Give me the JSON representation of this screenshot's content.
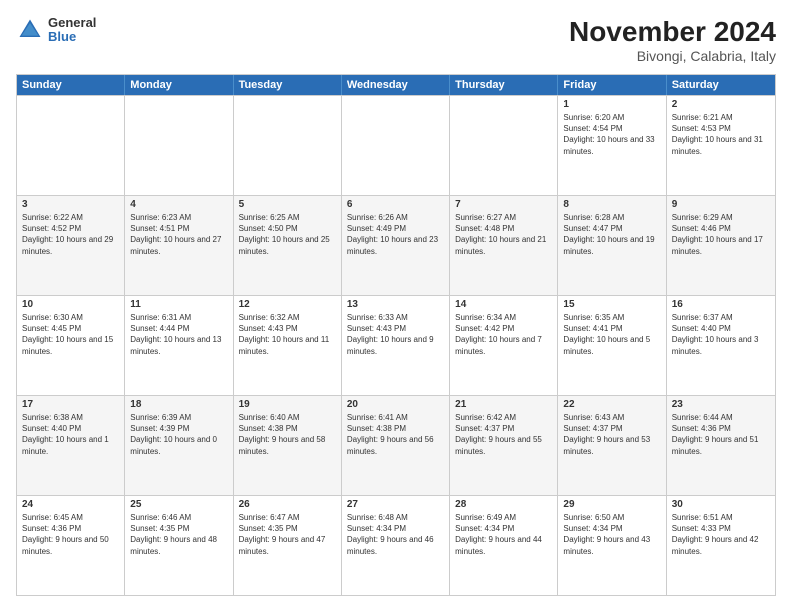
{
  "logo": {
    "general": "General",
    "blue": "Blue"
  },
  "title": "November 2024",
  "subtitle": "Bivongi, Calabria, Italy",
  "days": [
    "Sunday",
    "Monday",
    "Tuesday",
    "Wednesday",
    "Thursday",
    "Friday",
    "Saturday"
  ],
  "rows": [
    [
      {
        "num": "",
        "info": ""
      },
      {
        "num": "",
        "info": ""
      },
      {
        "num": "",
        "info": ""
      },
      {
        "num": "",
        "info": ""
      },
      {
        "num": "",
        "info": ""
      },
      {
        "num": "1",
        "info": "Sunrise: 6:20 AM\nSunset: 4:54 PM\nDaylight: 10 hours and 33 minutes."
      },
      {
        "num": "2",
        "info": "Sunrise: 6:21 AM\nSunset: 4:53 PM\nDaylight: 10 hours and 31 minutes."
      }
    ],
    [
      {
        "num": "3",
        "info": "Sunrise: 6:22 AM\nSunset: 4:52 PM\nDaylight: 10 hours and 29 minutes."
      },
      {
        "num": "4",
        "info": "Sunrise: 6:23 AM\nSunset: 4:51 PM\nDaylight: 10 hours and 27 minutes."
      },
      {
        "num": "5",
        "info": "Sunrise: 6:25 AM\nSunset: 4:50 PM\nDaylight: 10 hours and 25 minutes."
      },
      {
        "num": "6",
        "info": "Sunrise: 6:26 AM\nSunset: 4:49 PM\nDaylight: 10 hours and 23 minutes."
      },
      {
        "num": "7",
        "info": "Sunrise: 6:27 AM\nSunset: 4:48 PM\nDaylight: 10 hours and 21 minutes."
      },
      {
        "num": "8",
        "info": "Sunrise: 6:28 AM\nSunset: 4:47 PM\nDaylight: 10 hours and 19 minutes."
      },
      {
        "num": "9",
        "info": "Sunrise: 6:29 AM\nSunset: 4:46 PM\nDaylight: 10 hours and 17 minutes."
      }
    ],
    [
      {
        "num": "10",
        "info": "Sunrise: 6:30 AM\nSunset: 4:45 PM\nDaylight: 10 hours and 15 minutes."
      },
      {
        "num": "11",
        "info": "Sunrise: 6:31 AM\nSunset: 4:44 PM\nDaylight: 10 hours and 13 minutes."
      },
      {
        "num": "12",
        "info": "Sunrise: 6:32 AM\nSunset: 4:43 PM\nDaylight: 10 hours and 11 minutes."
      },
      {
        "num": "13",
        "info": "Sunrise: 6:33 AM\nSunset: 4:43 PM\nDaylight: 10 hours and 9 minutes."
      },
      {
        "num": "14",
        "info": "Sunrise: 6:34 AM\nSunset: 4:42 PM\nDaylight: 10 hours and 7 minutes."
      },
      {
        "num": "15",
        "info": "Sunrise: 6:35 AM\nSunset: 4:41 PM\nDaylight: 10 hours and 5 minutes."
      },
      {
        "num": "16",
        "info": "Sunrise: 6:37 AM\nSunset: 4:40 PM\nDaylight: 10 hours and 3 minutes."
      }
    ],
    [
      {
        "num": "17",
        "info": "Sunrise: 6:38 AM\nSunset: 4:40 PM\nDaylight: 10 hours and 1 minute."
      },
      {
        "num": "18",
        "info": "Sunrise: 6:39 AM\nSunset: 4:39 PM\nDaylight: 10 hours and 0 minutes."
      },
      {
        "num": "19",
        "info": "Sunrise: 6:40 AM\nSunset: 4:38 PM\nDaylight: 9 hours and 58 minutes."
      },
      {
        "num": "20",
        "info": "Sunrise: 6:41 AM\nSunset: 4:38 PM\nDaylight: 9 hours and 56 minutes."
      },
      {
        "num": "21",
        "info": "Sunrise: 6:42 AM\nSunset: 4:37 PM\nDaylight: 9 hours and 55 minutes."
      },
      {
        "num": "22",
        "info": "Sunrise: 6:43 AM\nSunset: 4:37 PM\nDaylight: 9 hours and 53 minutes."
      },
      {
        "num": "23",
        "info": "Sunrise: 6:44 AM\nSunset: 4:36 PM\nDaylight: 9 hours and 51 minutes."
      }
    ],
    [
      {
        "num": "24",
        "info": "Sunrise: 6:45 AM\nSunset: 4:36 PM\nDaylight: 9 hours and 50 minutes."
      },
      {
        "num": "25",
        "info": "Sunrise: 6:46 AM\nSunset: 4:35 PM\nDaylight: 9 hours and 48 minutes."
      },
      {
        "num": "26",
        "info": "Sunrise: 6:47 AM\nSunset: 4:35 PM\nDaylight: 9 hours and 47 minutes."
      },
      {
        "num": "27",
        "info": "Sunrise: 6:48 AM\nSunset: 4:34 PM\nDaylight: 9 hours and 46 minutes."
      },
      {
        "num": "28",
        "info": "Sunrise: 6:49 AM\nSunset: 4:34 PM\nDaylight: 9 hours and 44 minutes."
      },
      {
        "num": "29",
        "info": "Sunrise: 6:50 AM\nSunset: 4:34 PM\nDaylight: 9 hours and 43 minutes."
      },
      {
        "num": "30",
        "info": "Sunrise: 6:51 AM\nSunset: 4:33 PM\nDaylight: 9 hours and 42 minutes."
      }
    ]
  ]
}
